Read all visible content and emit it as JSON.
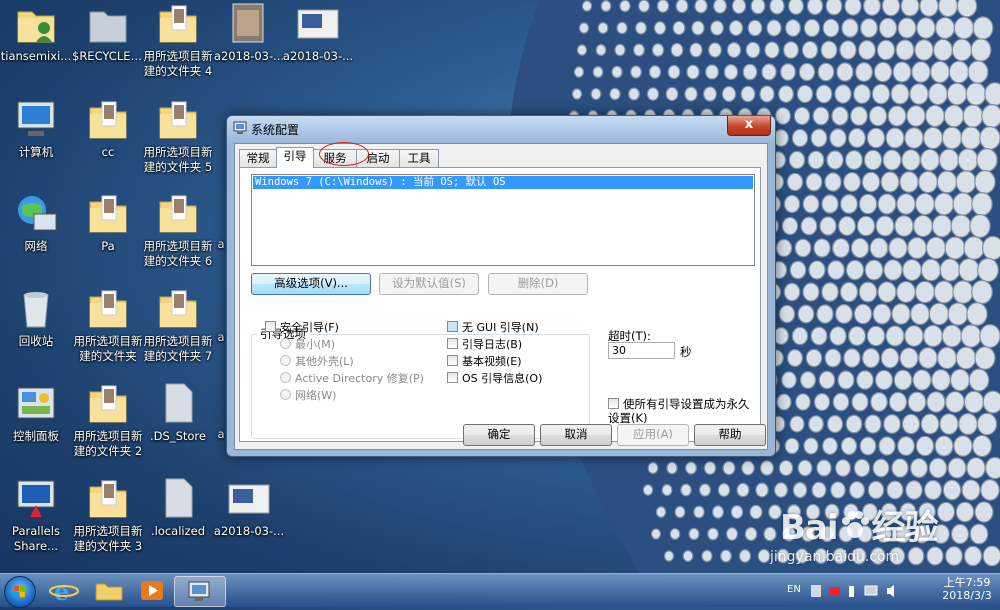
{
  "desktop": {
    "icons": [
      {
        "label": "tiansemixi...",
        "label2": "",
        "kind": "user-folder-icon"
      },
      {
        "label": "$RECYCLE....",
        "label2": "",
        "kind": "recycle-folder-icon"
      },
      {
        "label": "用所选项目新",
        "label2": "建的文件夹 4",
        "kind": "folder-icon"
      },
      {
        "label": "a2018-03-...",
        "label2": "",
        "kind": "image-file-icon"
      },
      {
        "label": "a2018-03-...",
        "label2": "",
        "kind": "screenshot-file-icon"
      },
      {
        "label": "计算机",
        "label2": "",
        "kind": "computer-icon"
      },
      {
        "label": "cc",
        "label2": "",
        "kind": "folder-icon"
      },
      {
        "label": "用所选项目新",
        "label2": "建的文件夹 5",
        "kind": "folder-icon"
      },
      {
        "label": "网络",
        "label2": "",
        "kind": "network-icon"
      },
      {
        "label": "Pa",
        "label2": "",
        "kind": "folder-icon"
      },
      {
        "label": "用所选项目新",
        "label2": "建的文件夹 6",
        "kind": "folder-icon"
      },
      {
        "label": "回收站",
        "label2": "",
        "kind": "recycle-bin-icon"
      },
      {
        "label": "用所选项目新",
        "label2": "建的文件夹",
        "kind": "folder-icon"
      },
      {
        "label": "用所选项目新",
        "label2": "建的文件夹 7",
        "kind": "folder-icon"
      },
      {
        "label": "控制面板",
        "label2": "",
        "kind": "control-panel-icon"
      },
      {
        "label": "用所选项目新",
        "label2": "建的文件夹 2",
        "kind": "folder-icon"
      },
      {
        "label": ".DS_Store",
        "label2": "",
        "kind": "blank-file-icon"
      },
      {
        "label": "Parallels",
        "label2": "Share...",
        "kind": "parallels-share-icon"
      },
      {
        "label": "用所选项目新",
        "label2": "建的文件夹 3",
        "kind": "folder-icon"
      },
      {
        "label": ".localized",
        "label2": "",
        "kind": "blank-file-icon"
      },
      {
        "label": "a2018-03-...",
        "label2": "",
        "kind": "screenshot-file-icon"
      }
    ],
    "partial_label": "a"
  },
  "dialog": {
    "title": "系统配置",
    "close_glyph": "x",
    "tabs": [
      "常规",
      "引导",
      "服务",
      "启动",
      "工具"
    ],
    "active_tab": 1,
    "os_entry": "Windows 7 (C:\\Windows) : 当前 OS; 默认 OS",
    "buttons": {
      "advanced": "高级选项(V)...",
      "set_default": "设为默认值(S)",
      "delete": "删除(D)",
      "ok": "确定",
      "cancel": "取消",
      "apply": "应用(A)",
      "help": "帮助"
    },
    "boot_options": {
      "title": "引导选项",
      "safe_boot": "安全引导(F)",
      "minimal": "最小(M)",
      "alternate_shell": "其他外壳(L)",
      "active_directory": "Active Directory 修复(P)",
      "network": "网络(W)",
      "no_gui": "无 GUI 引导(N)",
      "boot_log": "引导日志(B)",
      "base_video": "基本视频(E)",
      "os_info": "OS 引导信息(O)"
    },
    "timeout": {
      "label": "超时(T):",
      "value": "30",
      "unit": "秒"
    },
    "permanent": "使所有引导设置成为永久设置(K)"
  },
  "taskbar": {
    "tray_lang": "EN",
    "time": "上午7:59",
    "date": "2018/3/3"
  },
  "watermark": {
    "brand": "Bai",
    "brand2": "经验",
    "url": "jingyan.baidu.com"
  }
}
